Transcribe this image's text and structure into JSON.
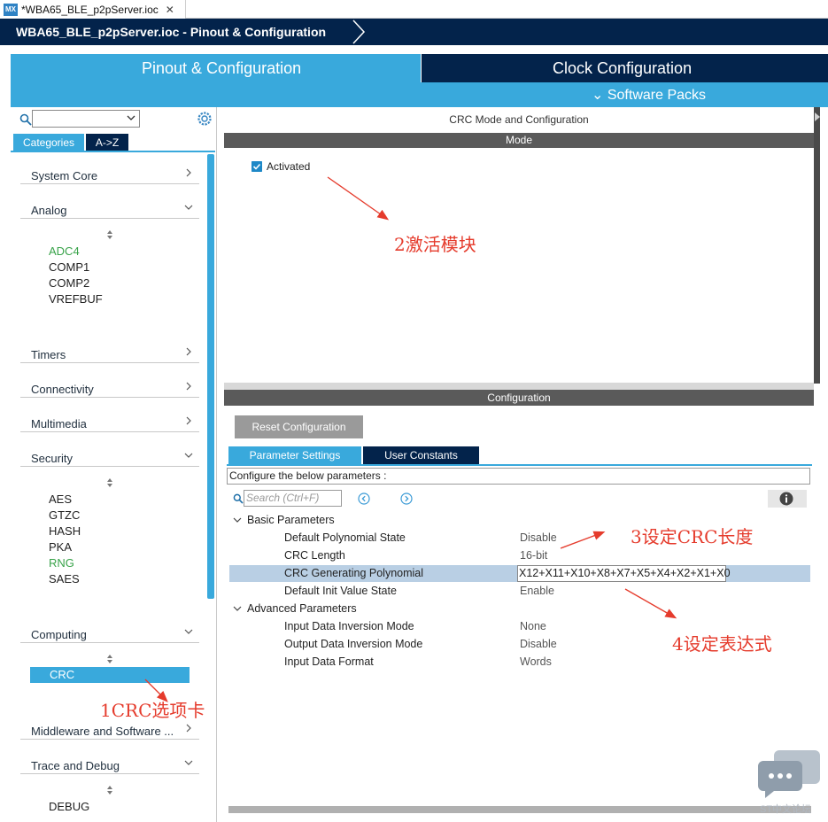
{
  "editor_tab": {
    "icon_text": "MX",
    "label": "*WBA65_BLE_p2pServer.ioc",
    "close": "✕"
  },
  "breadcrumb": {
    "label": "WBA65_BLE_p2pServer.ioc - Pinout & Configuration"
  },
  "header": {
    "pinout_tab": "Pinout & Configuration",
    "clock_tab": "Clock Configuration",
    "software_packs": "Software Packs",
    "software_packs_chevron": "chevron-down-icon"
  },
  "colors": {
    "accent": "#39a9dc",
    "navy": "#03234b",
    "bar_gray": "#5a5a5a",
    "enabled_green": "#39a34a",
    "annotation_red": "#e53b2c",
    "selected_row": "#b9cfe4"
  },
  "left": {
    "search_value": "",
    "tabs": {
      "categories": "Categories",
      "az": "A->Z"
    },
    "categories": [
      {
        "label": "System Core",
        "chevron": ">"
      },
      {
        "label": "Analog",
        "chevron": "v"
      },
      {
        "label": "Timers",
        "chevron": ">"
      },
      {
        "label": "Connectivity",
        "chevron": ">"
      },
      {
        "label": "Multimedia",
        "chevron": ">"
      },
      {
        "label": "Security",
        "chevron": "v"
      },
      {
        "label": "Computing",
        "chevron": "v"
      },
      {
        "label": "Middleware and Software ...",
        "chevron": ">"
      },
      {
        "label": "Trace and Debug",
        "chevron": "v"
      }
    ],
    "analog_items": [
      "ADC4",
      "COMP1",
      "COMP2",
      "VREFBUF"
    ],
    "security_items": [
      "AES",
      "GTZC",
      "HASH",
      "PKA",
      "RNG",
      "SAES"
    ],
    "computing_items": [
      "CRC"
    ],
    "debug_items": [
      "DEBUG"
    ]
  },
  "mode": {
    "title": "CRC Mode and Configuration",
    "section": "Mode",
    "activated_label": "Activated",
    "activated_checked": true
  },
  "config": {
    "section": "Configuration",
    "reset_button": "Reset Configuration",
    "tabs": {
      "params": "Parameter Settings",
      "user_constants": "User Constants"
    },
    "configure_text": "Configure the below parameters :",
    "search_placeholder": "Search (Ctrl+F)",
    "groups": [
      {
        "label": "Basic Parameters",
        "rows": [
          {
            "name": "Default Polynomial State",
            "value": "Disable"
          },
          {
            "name": "CRC Length",
            "value": "16-bit"
          },
          {
            "name": "CRC Generating Polynomial",
            "value": "X12+X11+X10+X8+X7+X5+X4+X2+X1+X0"
          },
          {
            "name": "Default Init Value State",
            "value": "Enable"
          }
        ]
      },
      {
        "label": "Advanced Parameters",
        "rows": [
          {
            "name": "Input Data Inversion Mode",
            "value": "None"
          },
          {
            "name": "Output Data Inversion Mode",
            "value": "Disable"
          },
          {
            "name": "Input Data Format",
            "value": "Words"
          }
        ]
      }
    ]
  },
  "annotations": {
    "a1": "1CRC选项卡",
    "a2": "2激活模块",
    "a3": "3设定CRC长度",
    "a4": "4设定表达式"
  },
  "watermark": "ST中文论坛"
}
